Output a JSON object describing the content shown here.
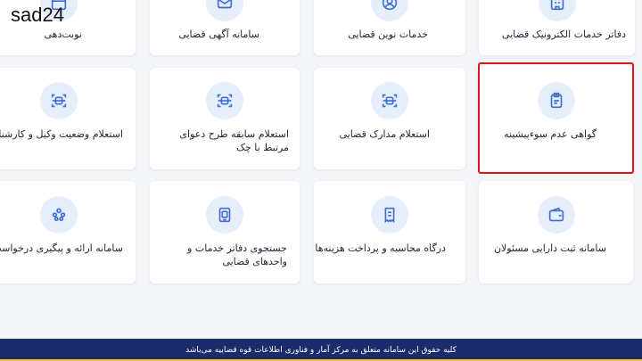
{
  "watermark": "sad24",
  "accent_color": "#3c6fd1",
  "highlight_color": "#e0141e",
  "rows": [
    [
      {
        "label": "دفاتر خدمات الکترونیک قضایی",
        "icon": "building-icon"
      },
      {
        "label": "خدمات نوین قضایی",
        "icon": "user-icon"
      },
      {
        "label": "سامانه آگهی قضایی",
        "icon": "envelope-icon"
      },
      {
        "label": "نوبت‌دهی",
        "icon": "calendar-icon"
      }
    ],
    [
      {
        "label": "گواهی عدم سوءپیشینه",
        "icon": "clipboard-icon"
      },
      {
        "label": "استعلام مدارک قضایی",
        "icon": "scan-icon"
      },
      {
        "label": "استعلام سابقه طرح دعوای مرتبط با چک",
        "icon": "scan-icon"
      },
      {
        "label": "استعلام وضعیت وکیل و کارشناس",
        "icon": "scan-icon"
      }
    ],
    [
      {
        "label": "سامانه ثبت دارایی مسئولان",
        "icon": "wallet-icon"
      },
      {
        "label": "درگاه محاسبه و پرداخت هزینه‌ها",
        "icon": "receipt-icon"
      },
      {
        "label": "جستجوی دفاتر خدمات و واحدهای قضایی",
        "icon": "document-search-icon"
      },
      {
        "label": "سامانه ارائه و پیگیری درخواست عفو",
        "icon": "people-icon"
      }
    ]
  ],
  "footer": {
    "text": "کلیه حقوق این سامانه متعلق به مرکز آمار و فناوری اطلاعات قوه قضاییه می‌باشد"
  }
}
